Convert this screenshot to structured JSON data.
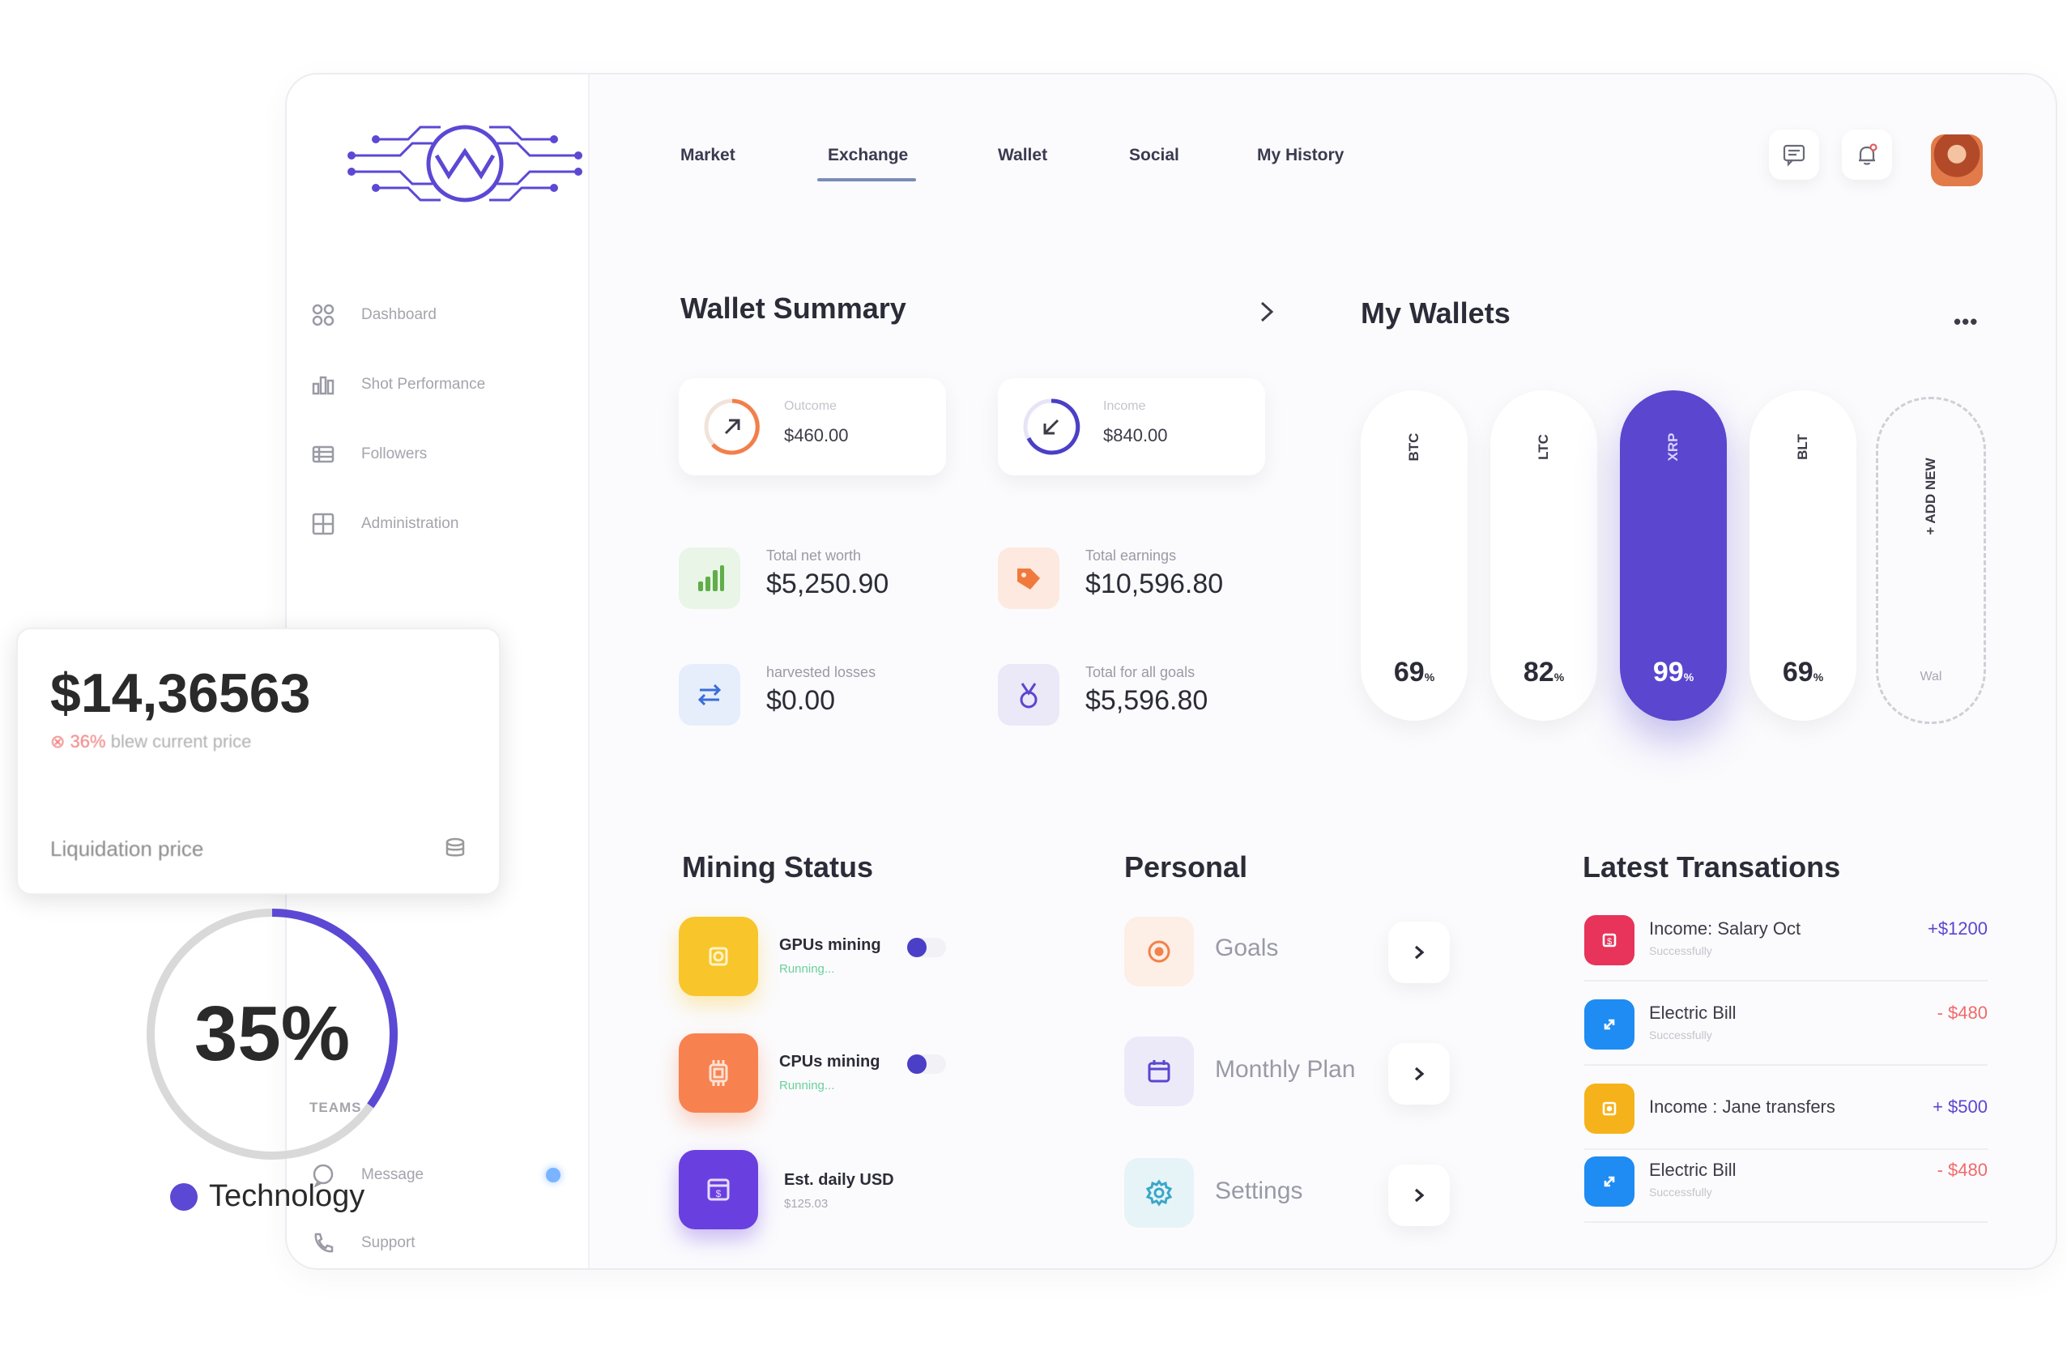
{
  "nav": {
    "items": [
      "Market",
      "Exchange",
      "Wallet",
      "Social",
      "My History"
    ],
    "active": "Exchange"
  },
  "sidebar": {
    "items": [
      {
        "label": "Dashboard",
        "icon": "grid-icon"
      },
      {
        "label": "Shot Performance",
        "icon": "chart-icon"
      },
      {
        "label": "Followers",
        "icon": "list-icon"
      },
      {
        "label": "Administration",
        "icon": "table-icon"
      }
    ],
    "bottom": [
      {
        "label": "Message",
        "icon": "chat-icon"
      },
      {
        "label": "Support",
        "icon": "phone-icon"
      }
    ],
    "teams_label": "TEAMS"
  },
  "wallet_summary": {
    "title": "Wallet Summary",
    "outcome": {
      "label": "Outcome",
      "value": "$460.00"
    },
    "income": {
      "label": "Income",
      "value": "$840.00"
    },
    "stats": [
      {
        "label": "Total net worth",
        "value": "$5,250.90"
      },
      {
        "label": "Total earnings",
        "value": "$10,596.80"
      },
      {
        "label": "harvested losses",
        "value": "$0.00"
      },
      {
        "label": "Total for all goals",
        "value": "$5,596.80"
      }
    ]
  },
  "my_wallets": {
    "title": "My Wallets",
    "items": [
      {
        "coin": "BTC",
        "pct": "69",
        "unit": "%"
      },
      {
        "coin": "LTC",
        "pct": "82",
        "unit": "%"
      },
      {
        "coin": "XRP",
        "pct": "99",
        "unit": "%"
      },
      {
        "coin": "BLT",
        "pct": "69",
        "unit": "%"
      }
    ],
    "add_label": "+ ADD NEW",
    "add_sub": "Wal"
  },
  "mining": {
    "title": "Mining Status",
    "items": [
      {
        "title": "GPUs mining",
        "sub": "Running..."
      },
      {
        "title": "CPUs mining",
        "sub": "Running..."
      },
      {
        "title": "Est. daily USD",
        "sub": "$125.03"
      }
    ]
  },
  "personal": {
    "title": "Personal",
    "items": [
      "Goals",
      "Monthly Plan",
      "Settings"
    ]
  },
  "transactions": {
    "title": "Latest Transations",
    "items": [
      {
        "name": "Income: Salary Oct",
        "sub": "Successfully",
        "amount": "+$1200",
        "color": "#e8335a",
        "amount_color": "#5a46cf"
      },
      {
        "name": "Electric Bill",
        "sub": "Successfully",
        "amount": "- $480",
        "color": "#1e8cf2",
        "amount_color": "#f06a6a"
      },
      {
        "name": "Income : Jane transfers",
        "sub": "",
        "amount": "+ $500",
        "color": "#f6b21a",
        "amount_color": "#5a46cf"
      },
      {
        "name": "Electric Bill",
        "sub": "Successfully",
        "amount": "- $480",
        "color": "#1e8cf2",
        "amount_color": "#f06a6a"
      }
    ]
  },
  "price_card": {
    "value": "$14,36563",
    "note_red": "36%",
    "note": " blew current price",
    "footer": "Liquidation price"
  },
  "progress": {
    "value": 35,
    "label": "35%",
    "legend": "Technology",
    "color": "#5b48d4"
  }
}
